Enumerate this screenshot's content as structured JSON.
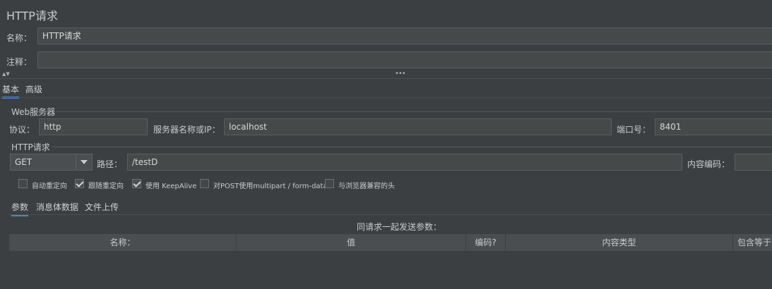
{
  "header": {
    "title": "HTTP请求"
  },
  "name_field": {
    "label": "名称：",
    "value": "HTTP请求"
  },
  "comment_field": {
    "label": "注释：",
    "value": ""
  },
  "main_tabs": [
    {
      "label": "基本"
    },
    {
      "label": "高级"
    }
  ],
  "web_server": {
    "group_title": "Web服务器",
    "protocol_label": "协议：",
    "protocol_value": "http",
    "server_label": "服务器名称或IP：",
    "server_value": "localhost",
    "port_label": "端口号：",
    "port_value": "8401"
  },
  "http_request": {
    "group_title": "HTTP请求",
    "method_value": "GET",
    "path_label": "路径：",
    "path_value": "/testD",
    "encoding_label": "内容编码：",
    "encoding_value": ""
  },
  "options": [
    {
      "label": "自动重定向",
      "checked": false
    },
    {
      "label": "跟随重定向",
      "checked": true
    },
    {
      "label": "使用 KeepAlive",
      "checked": true
    },
    {
      "label": "对POST使用multipart / form-data",
      "checked": false
    },
    {
      "label": "与浏览器兼容的头",
      "checked": false
    }
  ],
  "sub_tabs": [
    {
      "label": "参数"
    },
    {
      "label": "消息体数据"
    },
    {
      "label": "文件上传"
    }
  ],
  "params": {
    "caption": "同请求一起发送参数：",
    "columns": [
      "名称：",
      "值",
      "编码?",
      "内容类型",
      "包含等于?"
    ]
  },
  "colors": {
    "background": "#3b3f41",
    "accent": "#4a88c7",
    "field": "#45494a"
  }
}
